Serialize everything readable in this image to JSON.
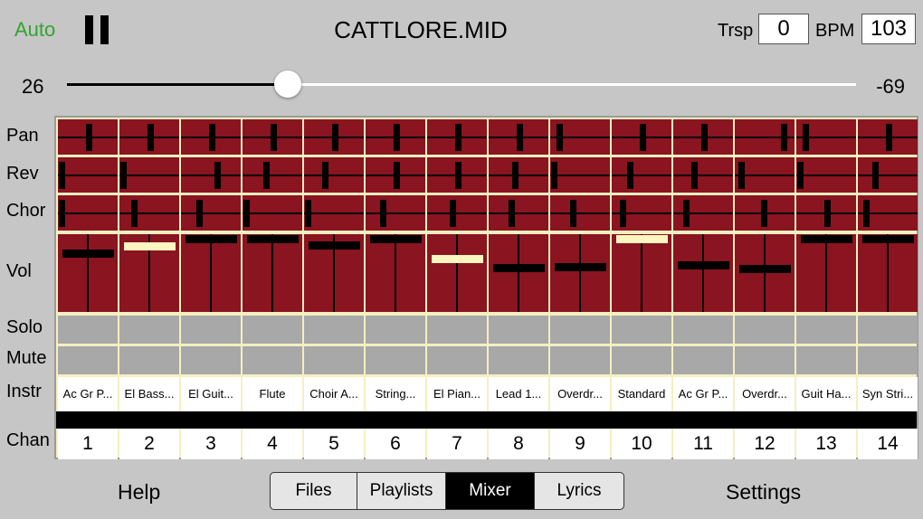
{
  "header": {
    "auto_label": "Auto",
    "title": "CATTLORE.MID",
    "trsp_label": "Trsp",
    "trsp_value": "0",
    "bpm_label": "BPM",
    "bpm_value": "103"
  },
  "slider": {
    "left_label": "26",
    "right_label": "-69",
    "fraction": 0.28
  },
  "row_labels": {
    "pan": "Pan",
    "rev": "Rev",
    "chor": "Chor",
    "vol": "Vol",
    "solo": "Solo",
    "mute": "Mute",
    "instr": "Instr",
    "chan": "Chan"
  },
  "channels": [
    {
      "chan": "1",
      "instr": "Ac Gr P...",
      "pan": 0.51,
      "rev": 0.0,
      "chor": 0.0,
      "vol": 0.78,
      "vol_selected": false
    },
    {
      "chan": "2",
      "instr": "El Bass...",
      "pan": 0.51,
      "rev": 0.0,
      "chor": 0.2,
      "vol": 0.87,
      "vol_selected": true
    },
    {
      "chan": "3",
      "instr": "El Guit...",
      "pan": 0.51,
      "rev": 0.62,
      "chor": 0.28,
      "vol": 0.96,
      "vol_selected": false
    },
    {
      "chan": "4",
      "instr": "Flute",
      "pan": 0.51,
      "rev": 0.38,
      "chor": 0.0,
      "vol": 0.96,
      "vol_selected": false
    },
    {
      "chan": "5",
      "instr": "Choir A...",
      "pan": 0.51,
      "rev": 0.33,
      "chor": 0.0,
      "vol": 0.88,
      "vol_selected": false
    },
    {
      "chan": "6",
      "instr": "String...",
      "pan": 0.51,
      "rev": 0.51,
      "chor": 0.26,
      "vol": 0.96,
      "vol_selected": false
    },
    {
      "chan": "7",
      "instr": "El Pian...",
      "pan": 0.51,
      "rev": 0.51,
      "chor": 0.42,
      "vol": 0.71,
      "vol_selected": true
    },
    {
      "chan": "8",
      "instr": "Lead 1...",
      "pan": 0.51,
      "rev": 0.43,
      "chor": 0.37,
      "vol": 0.59,
      "vol_selected": false
    },
    {
      "chan": "9",
      "instr": "Overdr...",
      "pan": 0.1,
      "rev": 0.0,
      "chor": 0.37,
      "vol": 0.6,
      "vol_selected": false
    },
    {
      "chan": "10",
      "instr": "Standard",
      "pan": 0.51,
      "rev": 0.28,
      "chor": 0.13,
      "vol": 0.96,
      "vol_selected": true
    },
    {
      "chan": "11",
      "instr": "Ac Gr P...",
      "pan": 0.51,
      "rev": 0.33,
      "chor": 0.18,
      "vol": 0.63,
      "vol_selected": false
    },
    {
      "chan": "12",
      "instr": "Overdr...",
      "pan": 0.87,
      "rev": 0.05,
      "chor": 0.48,
      "vol": 0.58,
      "vol_selected": false
    },
    {
      "chan": "13",
      "instr": "Guit Ha...",
      "pan": 0.1,
      "rev": 0.0,
      "chor": 0.52,
      "vol": 0.96,
      "vol_selected": false
    },
    {
      "chan": "14",
      "instr": "Syn Stri...",
      "pan": 0.51,
      "rev": 0.25,
      "chor": 0.08,
      "vol": 0.96,
      "vol_selected": false
    }
  ],
  "tabs": [
    {
      "label": "Files",
      "active": false
    },
    {
      "label": "Playlists",
      "active": false
    },
    {
      "label": "Mixer",
      "active": true
    },
    {
      "label": "Lyrics",
      "active": false
    }
  ],
  "footer": {
    "help_label": "Help",
    "settings_label": "Settings"
  }
}
